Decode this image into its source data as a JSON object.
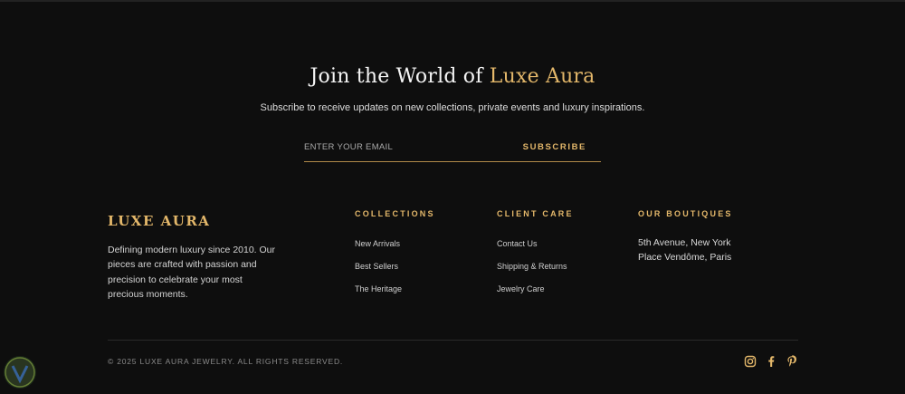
{
  "newsletter": {
    "heading_prefix": "Join the World of ",
    "heading_accent": "Luxe Aura",
    "subtitle": "Subscribe to receive updates on new collections, private events and luxury inspirations.",
    "email_placeholder": "ENTER YOUR EMAIL",
    "subscribe_label": "SUBSCRIBE"
  },
  "brand": {
    "name": "LUXE AURA",
    "description": "Defining modern luxury since 2010. Our pieces are crafted with passion and precision to celebrate your most precious moments."
  },
  "columns": {
    "collections": {
      "title": "COLLECTIONS",
      "links": [
        "New Arrivals",
        "Best Sellers",
        "The Heritage"
      ]
    },
    "client_care": {
      "title": "CLIENT CARE",
      "links": [
        "Contact Us",
        "Shipping & Returns",
        "Jewelry Care"
      ]
    },
    "boutiques": {
      "title": "OUR BOUTIQUES",
      "lines": [
        "5th Avenue, New York",
        "Place Vendôme, Paris"
      ]
    }
  },
  "footer": {
    "copyright": "© 2025 LUXE AURA JEWELRY. ALL RIGHTS RESERVED.",
    "socials": [
      "instagram-icon",
      "facebook-icon",
      "pinterest-icon"
    ]
  },
  "colors": {
    "background": "#0e0e0e",
    "accent": "#e3b76a"
  }
}
